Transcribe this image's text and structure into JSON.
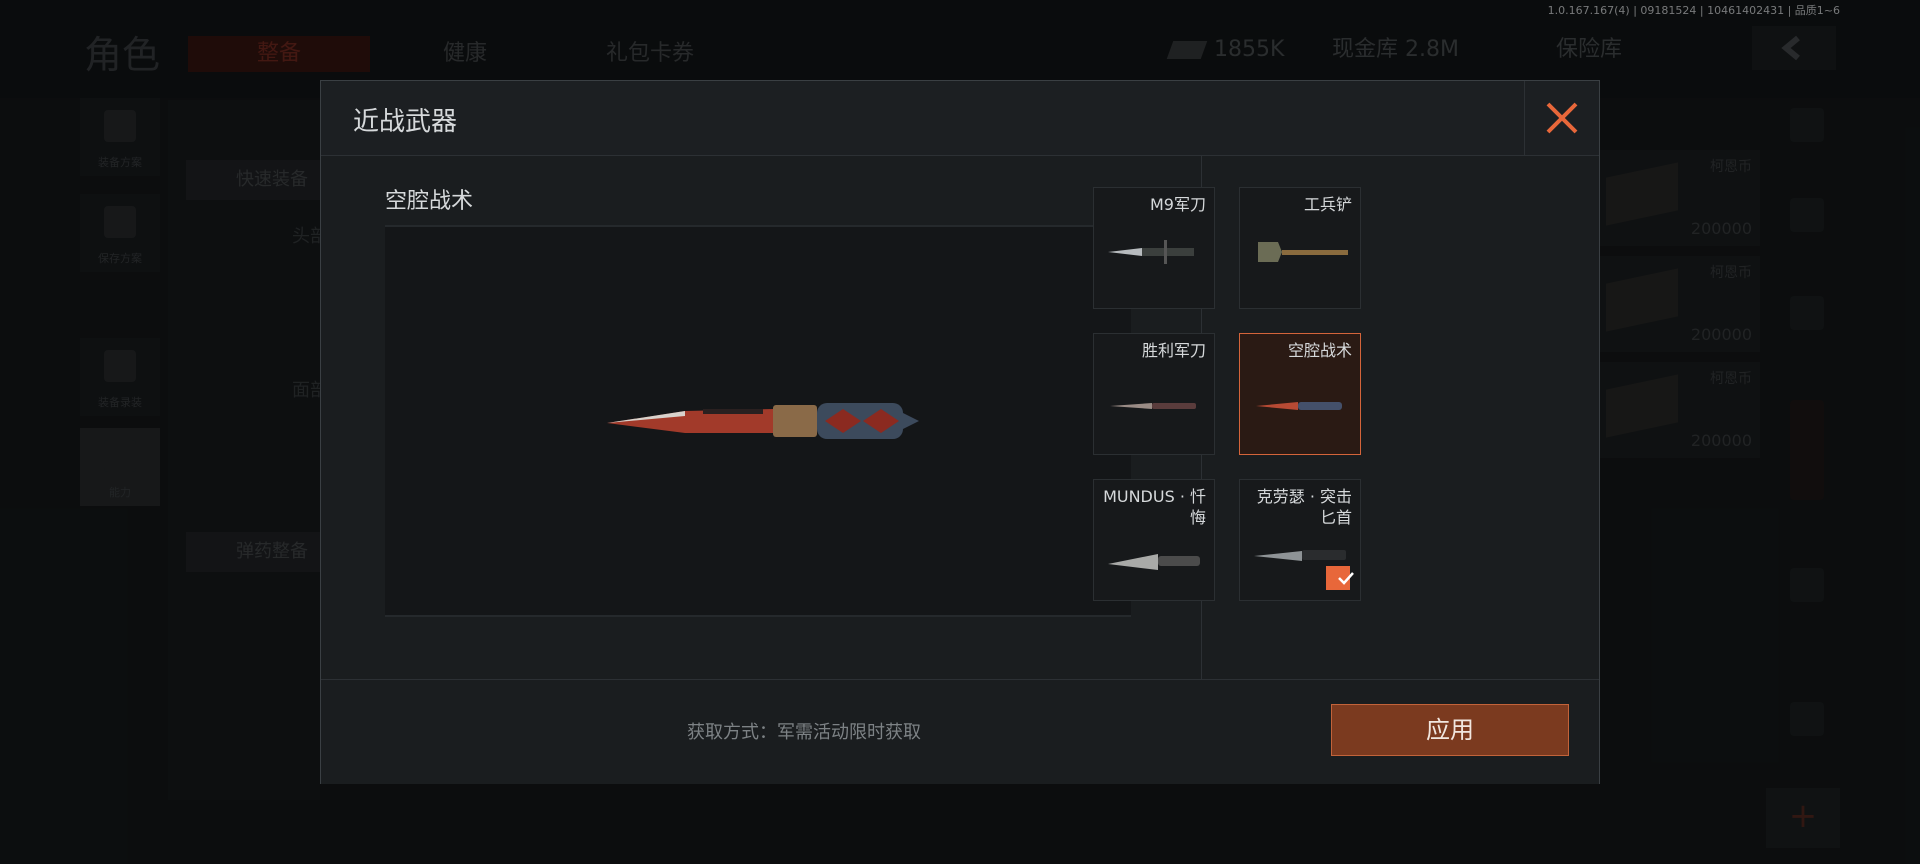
{
  "version": "1.0.167.167(4) | 09181524 | 10461402431 | 品质1~6",
  "background": {
    "title": "角色",
    "tabs": [
      "整备",
      "健康",
      "礼包卡券"
    ],
    "currency": "1855K",
    "cash_storage": "现金库 2.8M",
    "safe": "保险库",
    "side_items": [
      "装备方案",
      "保存方案",
      "装备录装",
      "能力"
    ],
    "quick_equip": "快速装备",
    "ammo_equip": "弹药整备",
    "slot_labels": [
      "头部",
      "面部"
    ],
    "cash_items": [
      {
        "name": "柯恩币",
        "value": "200000"
      },
      {
        "name": "柯恩币",
        "value": "200000"
      },
      {
        "name": "柯恩币",
        "value": "200000"
      }
    ]
  },
  "modal": {
    "title": "近战武器",
    "selected_name": "空腔战术",
    "weapons": [
      {
        "name": "M9军刀",
        "selected": false,
        "equipped": false
      },
      {
        "name": "工兵铲",
        "selected": false,
        "equipped": false
      },
      {
        "name": "胜利军刀",
        "selected": false,
        "equipped": false
      },
      {
        "name": "空腔战术",
        "selected": true,
        "equipped": false
      },
      {
        "name": "MUNDUS · 忏悔",
        "selected": false,
        "equipped": false
      },
      {
        "name": "克劳瑟 · 突击匕首",
        "selected": false,
        "equipped": true
      }
    ],
    "acquire_text": "获取方式：军需活动限时获取",
    "apply_label": "应用"
  },
  "colors": {
    "accent": "#e8673a",
    "apply_bg": "#7b3a1f"
  }
}
